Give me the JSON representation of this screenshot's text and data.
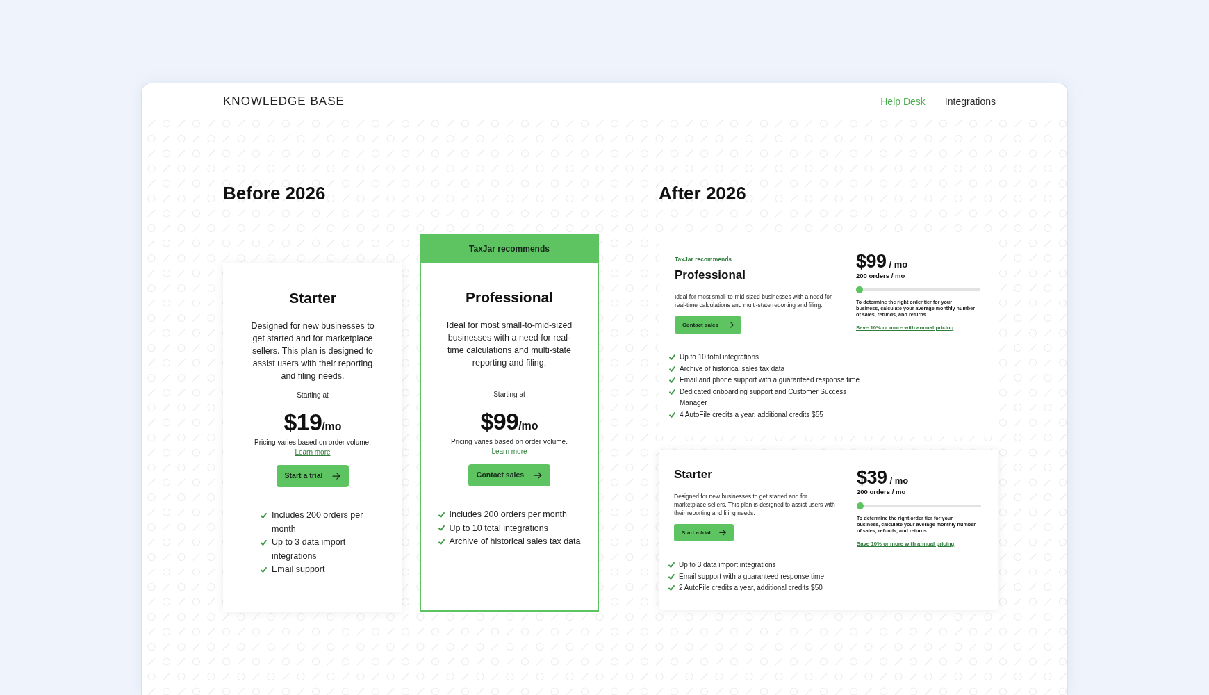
{
  "header": {
    "logo": "KNOWLEDGE BASE",
    "nav": [
      {
        "label": "Help Desk",
        "selected": true
      },
      {
        "label": "Integrations",
        "selected": false
      }
    ]
  },
  "sections": [
    {
      "kind": "columns",
      "title": "Before 2026",
      "plans": [
        {
          "name": "Starter",
          "recommended": false,
          "description": "Designed for new businesses to get started and for marketplace sellers. This plan is designed to assist users with their reporting and filing needs.",
          "price_label": "Starting at",
          "price": "$19",
          "period": "/mo",
          "note": "Pricing varies based on order volume.",
          "link": "Learn more",
          "button": "Start a trial",
          "features": [
            "Includes 200 orders per month",
            "Up to 3 data import integrations",
            "Email support"
          ]
        },
        {
          "badge": "TaxJar recommends",
          "name": "Professional",
          "recommended": true,
          "description": "Ideal for most small-to-mid-sized businesses with a need for real-time calculations and multi-state reporting and filing.",
          "price_label": "Starting at",
          "price": "$99",
          "period": "/mo",
          "note": "Pricing varies based on order volume.",
          "link": "Learn more",
          "button": "Contact sales",
          "features": [
            "Includes 200 orders per month",
            "Up to 10 total integrations",
            "Archive of historical sales tax data"
          ]
        }
      ]
    },
    {
      "kind": "rows",
      "title": "After 2026",
      "plans": [
        {
          "badge": "TaxJar recommends",
          "name": "Professional",
          "recommended": true,
          "description": "Ideal for most small-to-mid-sized businesses with a need for real-time calculations and multi-state reporting and filing.",
          "button": "Contact sales",
          "price": "$99",
          "period": "/ mo",
          "orders": "200 orders / mo",
          "level": 0,
          "hint": "To determine the right order tier for your business, calculate your average monthly number of sales, refunds, and returns.",
          "link": "Save 10% or more with annual pricing",
          "features": [
            "Up to 10 total integrations",
            "Archive of historical sales tax data",
            "Email and phone support with a guaranteed response time",
            "Dedicated onboarding support and Customer Success Manager",
            "4 AutoFile credits a year, additional credits $55"
          ]
        },
        {
          "name": "Starter",
          "recommended": false,
          "description": "Designed for new businesses to get started and for marketplace sellers. This plan is designed to assist users with their reporting and filing needs.",
          "button": "Start a trial",
          "price": "$39",
          "period": "/ mo",
          "orders": "200 orders / mo",
          "level": 0,
          "hint": "To determine the right order tier for your business, calculate your average monthly number of sales, refunds, and returns.",
          "link": "Save 10% or more with annual pricing",
          "features": [
            "Up to 3 data import integrations",
            "Email support with a guaranteed response time",
            "2 AutoFile credits a year, additional credits $50"
          ]
        }
      ]
    }
  ]
}
